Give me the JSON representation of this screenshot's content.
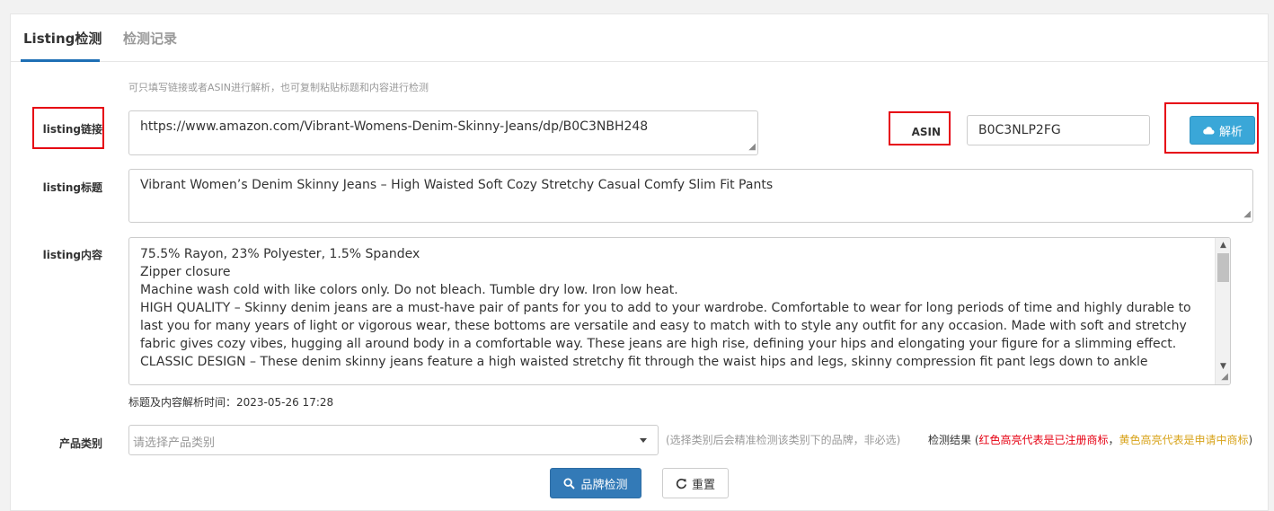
{
  "tabs": [
    {
      "label": "Listing检测",
      "active": true
    },
    {
      "label": "检测记录",
      "active": false
    }
  ],
  "hint": "可只填写链接或者ASIN进行解析，也可复制粘贴标题和内容进行检测",
  "link": {
    "label": "listing链接",
    "value": "https://www.amazon.com/Vibrant-Womens-Denim-Skinny-Jeans/dp/B0C3NBH248"
  },
  "asin": {
    "label": "ASIN",
    "value": "B0C3NLP2FG"
  },
  "parse_button": "解析",
  "title_field": {
    "label": "listing标题",
    "value": "Vibrant Women’s Denim Skinny Jeans – High Waisted Soft Cozy Stretchy Casual Comfy Slim Fit Pants"
  },
  "content_field": {
    "label": "listing内容",
    "value": "75.5% Rayon, 23% Polyester, 1.5% Spandex\nZipper closure\nMachine wash cold with like colors only. Do not bleach. Tumble dry low. Iron low heat.\nHIGH QUALITY – Skinny denim jeans are a must-have pair of pants for you to add to your wardrobe. Comfortable to wear for long periods of time and highly durable to last you for many years of light or vigorous wear, these bottoms are versatile and easy to match with to style any outfit for any occasion. Made with soft and stretchy fabric gives cozy vibes, hugging all around body in a comfortable way. These jeans are high rise, defining your hips and elongating your figure for a slimming effect.\nCLASSIC DESIGN – These denim skinny jeans feature a high waisted stretchy fit through the waist hips and legs, skinny compression fit pant legs down to ankle"
  },
  "parse_time": "标题及内容解析时间：2023-05-26 17:28",
  "category": {
    "label": "产品类别",
    "placeholder": "请选择产品类别",
    "note": "(选择类别后会精准检测该类别下的品牌，非必选)"
  },
  "result": {
    "prefix": "检测结果 (",
    "red_text": "红色高亮代表是已注册商标",
    "separator": "，",
    "yellow_text": "黄色高亮代表是申请中商标",
    "suffix": ")"
  },
  "buttons": {
    "check": "品牌检测",
    "reset": "重置"
  },
  "colors": {
    "primary": "#337ab7",
    "parse": "#3aa7d8",
    "highlight_red": "#e60012",
    "highlight_yellow": "#d8a31a"
  }
}
